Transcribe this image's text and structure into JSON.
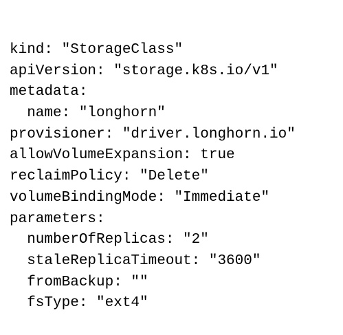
{
  "document": {
    "lines": [
      "kind: \"StorageClass\"",
      "apiVersion: \"storage.k8s.io/v1\"",
      "metadata:",
      "  name: \"longhorn\"",
      "provisioner: \"driver.longhorn.io\"",
      "allowVolumeExpansion: true",
      "reclaimPolicy: \"Delete\"",
      "volumeBindingMode: \"Immediate\"",
      "parameters:",
      "  numberOfReplicas: \"2\"",
      "  staleReplicaTimeout: \"3600\"",
      "  fromBackup: \"\"",
      "  fsType: \"ext4\""
    ]
  }
}
